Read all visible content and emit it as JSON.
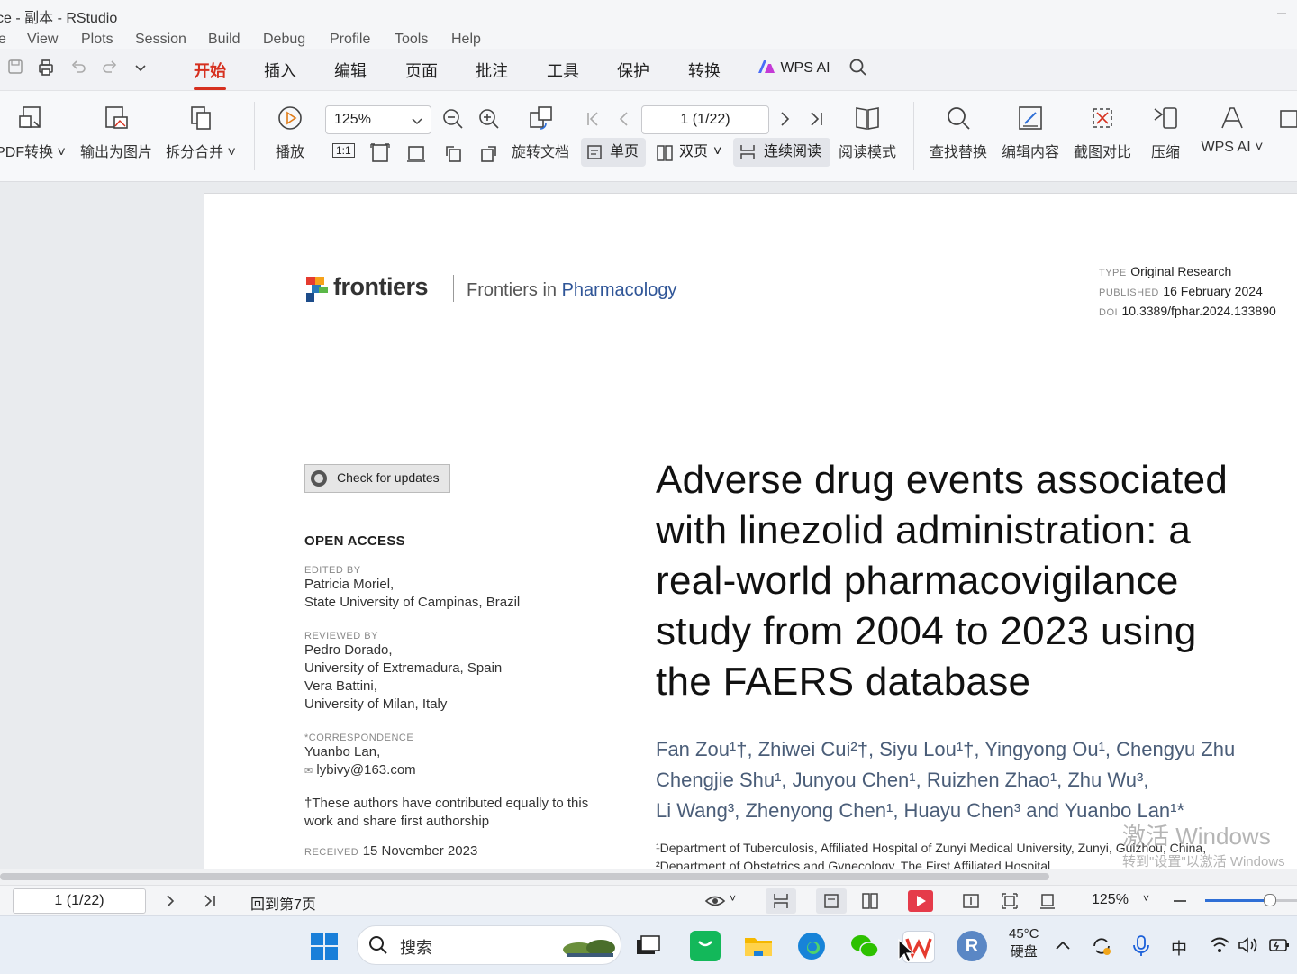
{
  "window": {
    "title": "ce - 副本 - RStudio",
    "minimize_glyph": "–"
  },
  "rstudio_menu": [
    "e",
    "View",
    "Plots",
    "Session",
    "Build",
    "Debug",
    "Profile",
    "Tools",
    "Help"
  ],
  "wps_tabs": {
    "items": [
      "开始",
      "插入",
      "编辑",
      "页面",
      "批注",
      "工具",
      "保护",
      "转换"
    ],
    "active": "开始",
    "wps_ai": "WPS AI"
  },
  "ribbon": {
    "pdf_convert": "PDF转换",
    "export_image": "输出为图片",
    "split_merge": "拆分合并",
    "play": "播放",
    "zoom_value": "125%",
    "page_value": "1 (1/22)",
    "actual_size_glyph": "1:1",
    "rotate_doc": "旋转文档",
    "single_page": "单页",
    "double_page": "双页",
    "continuous_read": "连续阅读",
    "read_mode": "阅读模式",
    "find_replace": "查找替换",
    "edit_content": "编辑内容",
    "screenshot_compare": "截图对比",
    "compress": "压缩",
    "wps_ai": "WPS AI"
  },
  "document": {
    "logo_text": "frontiers",
    "journal_prefix": "Frontiers in",
    "journal_name": "Pharmacology",
    "type_label": "TYPE",
    "type_value": "Original Research",
    "published_label": "PUBLISHED",
    "published_value": "16 February 2024",
    "doi_label": "DOI",
    "doi_value": "10.3389/fphar.2024.133890",
    "check_updates": "Check for updates",
    "open_access": "OPEN ACCESS",
    "edited_by_label": "EDITED BY",
    "edited_by": [
      "Patricia Moriel,",
      "State University of Campinas, Brazil"
    ],
    "reviewed_by_label": "REVIEWED BY",
    "reviewed_by": [
      "Pedro Dorado,",
      "University of Extremadura, Spain",
      "Vera Battini,",
      "University of Milan, Italy"
    ],
    "correspondence_label": "*CORRESPONDENCE",
    "correspondence_name": "Yuanbo Lan,",
    "correspondence_email": "lybivy@163.com",
    "equal_note": "†These authors have contributed equally to this work and share first authorship",
    "received_label": "RECEIVED",
    "received_value": "15 November 2023",
    "title_lines": [
      "Adverse drug events associated",
      "with linezolid administration: a",
      "real-world pharmacovigilance",
      "study from 2004 to 2023 using",
      "the FAERS database"
    ],
    "authors_lines": [
      "Fan Zou¹†, Zhiwei Cui²†, Siyu Lou¹†, Yingyong Ou¹, Chengyu Zhu",
      "Chengjie Shu¹, Junyou Chen¹, Ruizhen Zhao¹, Zhu Wu³,",
      "Li Wang³, Zhenyong Chen¹, Huayu Chen³ and Yuanbo Lan¹*"
    ],
    "affiliations": [
      "¹Department of Tuberculosis, Affiliated Hospital of Zunyi Medical University, Zunyi, Guizhou, China,",
      "²Department of Obstetrics and Gynecology, The First Affiliated Hospital..."
    ]
  },
  "watermark": {
    "line1": "激活 Windows",
    "line2": "转到\"设置\"以激活 Windows"
  },
  "statusbar": {
    "page_value": "1 (1/22)",
    "back_to_page": "回到第7页",
    "zoom_value": "125%"
  },
  "taskbar": {
    "search_placeholder": "搜索",
    "temperature": "45°C",
    "disk_label": "硬盘",
    "ime": "中"
  },
  "colors": {
    "accent_red": "#d6301f",
    "frontiers_blue": "#2f5597",
    "toggle_bg": "#e3e5ea"
  }
}
